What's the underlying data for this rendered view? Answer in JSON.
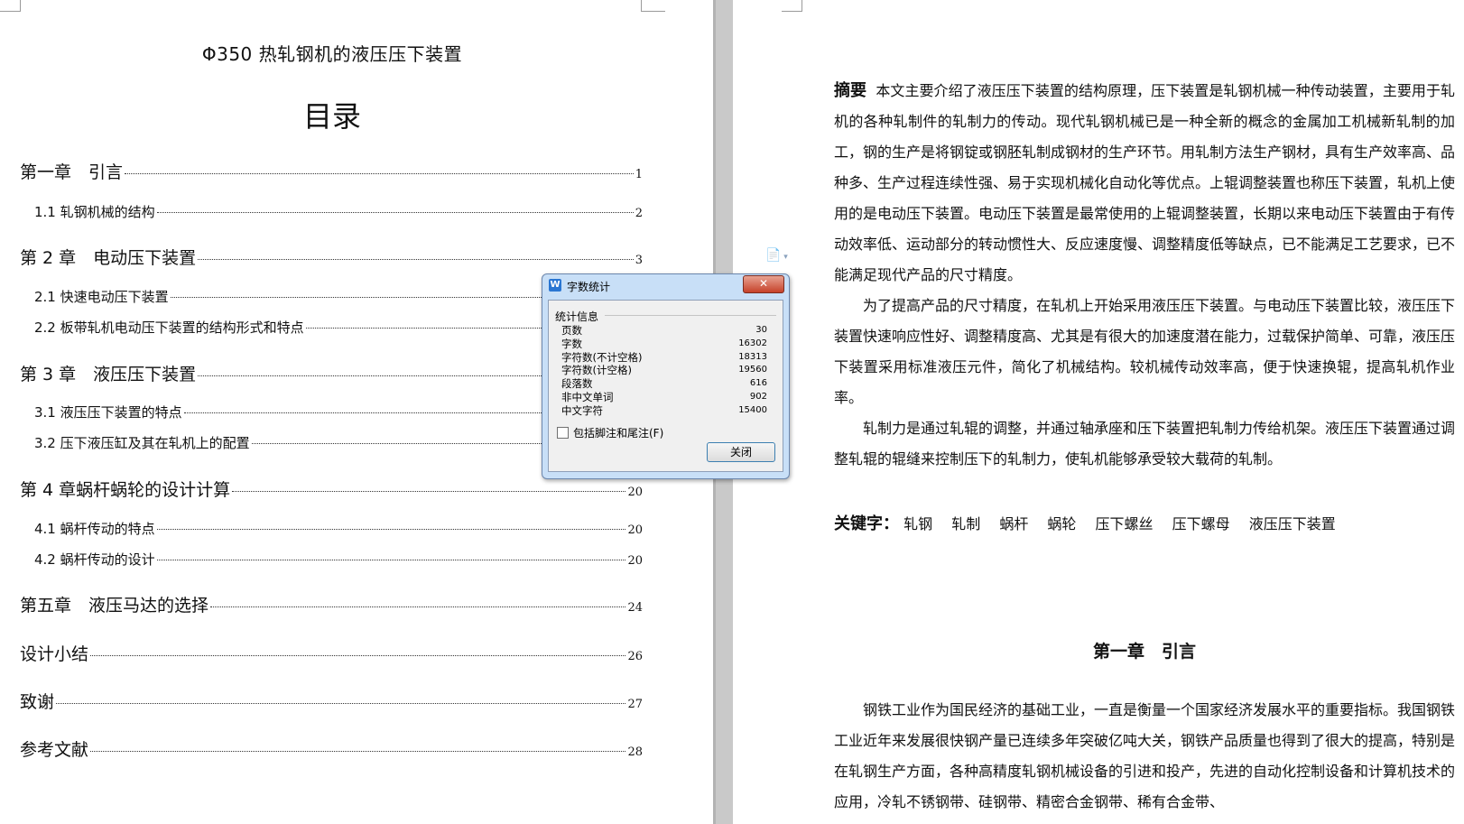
{
  "left_page": {
    "doc_title": "Φ350 热轧钢机的液压压下装置",
    "toc_heading": "目录",
    "toc": [
      {
        "label": "第一章　引言",
        "page": "1",
        "level": "chapter"
      },
      {
        "label": "1.1 轧钢机械的结构",
        "page": "2",
        "level": "section"
      },
      {
        "label": "第 2 章　电动压下装置",
        "page": "3",
        "level": "chapter"
      },
      {
        "label": "2.1 快速电动压下装置",
        "page": "",
        "level": "section"
      },
      {
        "label": "2.2 板带轧机电动压下装置的结构形式和特点",
        "page": "",
        "level": "section"
      },
      {
        "label": "第 3 章　液压压下装置",
        "page": "",
        "level": "chapter"
      },
      {
        "label": "3.1 液压压下装置的特点",
        "page": "",
        "level": "section"
      },
      {
        "label": "3.2 压下液压缸及其在轧机上的配置",
        "page": "",
        "level": "section"
      },
      {
        "label": "第 4 章蜗杆蜗轮的设计计算",
        "page": "20",
        "level": "chapter"
      },
      {
        "label": "4.1 蜗杆传动的特点",
        "page": "20",
        "level": "section"
      },
      {
        "label": "4.2 蜗杆传动的设计",
        "page": "20",
        "level": "section"
      },
      {
        "label": "第五章　液压马达的选择",
        "page": "24",
        "level": "chapter"
      },
      {
        "label": "设计小结",
        "page": "26",
        "level": "chapter"
      },
      {
        "label": "致谢",
        "page": "27",
        "level": "chapter"
      },
      {
        "label": "参考文献",
        "page": "28",
        "level": "chapter"
      }
    ]
  },
  "right_page": {
    "abstract_label": "摘要",
    "abstract_p1": "本文主要介绍了液压压下装置的结构原理，压下装置是轧钢机械一种传动装置，主要用于轧机的各种轧制件的轧制力的传动。现代轧钢机械已是一种全新的概念的金属加工机械新轧制的加工，钢的生产是将钢锭或钢胚轧制成钢材的生产环节。用轧制方法生产钢材，具有生产效率高、品种多、生产过程连续性强、易于实现机械化自动化等优点。上辊调整装置也称压下装置，轧机上使用的是电动压下装置。电动压下装置是最常使用的上辊调整装置，长期以来电动压下装置由于有传动效率低、运动部分的转动惯性大、反应速度慢、调整精度低等缺点，已不能满足工艺要求，已不能满足现代产品的尺寸精度。",
    "abstract_p2": "为了提高产品的尺寸精度，在轧机上开始采用液压压下装置。与电动压下装置比较，液压压下装置快速响应性好、调整精度高、尤其是有很大的加速度潜在能力，过载保护简单、可靠，液压压下装置采用标准液压元件，简化了机械结构。较机械传动效率高，便于快速换辊，提高轧机作业率。",
    "abstract_p3": "轧制力是通过轧辊的调整，并通过轴承座和压下装置把轧制力传给机架。液压压下装置通过调整轧辊的辊缝来控制压下的轧制力，使轧机能够承受较大载荷的轧制。",
    "keywords_label": "关键字：",
    "keywords": [
      "轧钢",
      "轧制",
      "蜗杆",
      "蜗轮",
      "压下螺丝",
      "压下螺母",
      "液压压下装置"
    ],
    "chapter_heading": "第一章　引言",
    "chapter_text": "钢铁工业作为国民经济的基础工业，一直是衡量一个国家经济发展水平的重要指标。我国钢铁工业近年来发展很快钢产量已连续多年突破亿吨大关，钢铁产品质量也得到了很大的提高，特别是在轧钢生产方面，各种高精度轧钢机械设备的引进和投产，先进的自动化控制设备和计算机技术的应用，冷轧不锈钢带、硅钢带、精密合金钢带、稀有合金带、"
  },
  "dialog": {
    "title": "字数统计",
    "close_x": "✕",
    "group_label": "统计信息",
    "stats": [
      {
        "label": "页数",
        "value": "30"
      },
      {
        "label": "字数",
        "value": "16302"
      },
      {
        "label": "字符数(不计空格)",
        "value": "18313"
      },
      {
        "label": "字符数(计空格)",
        "value": "19560"
      },
      {
        "label": "段落数",
        "value": "616"
      },
      {
        "label": "非中文单词",
        "value": "902"
      },
      {
        "label": "中文字符",
        "value": "15400"
      }
    ],
    "checkbox_label": "包括脚注和尾注(F)",
    "close_button": "关闭"
  },
  "icons": {
    "app": "wps-writer-icon",
    "floating": "document-icon"
  }
}
